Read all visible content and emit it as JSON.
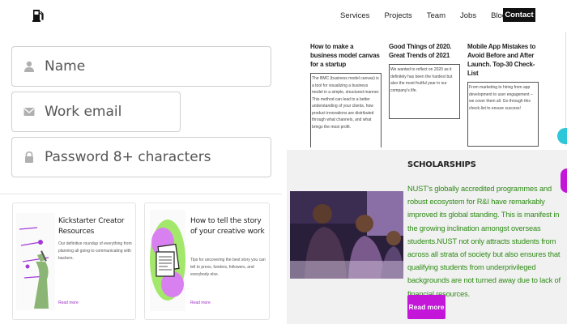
{
  "nav": {
    "items": [
      "Services",
      "Projects",
      "Team",
      "Jobs",
      "Blog"
    ],
    "contact": "Contact"
  },
  "form": {
    "name_placeholder": "Name",
    "email_placeholder": "Work email",
    "password_placeholder": "Password 8+ characters"
  },
  "cards": [
    {
      "title": "Kickstarter Creator Resources",
      "desc": "Our definitive roundup of everything from planning all going to communicating with backers.",
      "more": "Read more"
    },
    {
      "title": "How to tell the story of your creative work",
      "desc": "Tips for uncovering the best story you can tell to press, funders, followers, and everybody else.",
      "more": "Read more"
    }
  ],
  "posts": [
    {
      "title": "How to make a business model canvas for a startup",
      "text": "The BMC (business model canvas) is a tool for visualizing a business model in a simple, structured manner. This method can lead to a better understanding of your clients, how product innovations are distributed through what channels, and what brings the most profit."
    },
    {
      "title": "Good Things of 2020. Great Trends of 2021",
      "text": "We wanted to reflect on 2020 as it definitely has been the hardest but also the most fruitful year in our company's life."
    },
    {
      "title": "Mobile App Mistakes to Avoid Before and After Launch. Top-30 Check-List",
      "text": "From marketing to hiring from app development to user engagement – we cover them all. Go through this check-list to ensure success!"
    }
  ],
  "scholarships": {
    "title": "SCHOLARSHIPS",
    "text": "NUST's globally accredited programmes and robust ecosystem for R&I have remarkably improved its global standing. This is manifest in the growing inclination amongst overseas students.NUST not only attracts students from across all strata of society but also ensures that qualifying students from underprivileged backgrounds are not turned away due to lack of financial resources.",
    "button": "Read more"
  },
  "colors": {
    "accent_purple": "#c316d9",
    "scholar_text_green": "#2e8b16",
    "chat_cyan": "#2cc7d8"
  }
}
